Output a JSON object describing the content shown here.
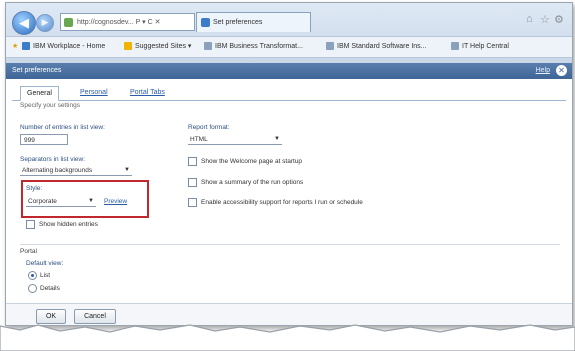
{
  "browser": {
    "address": "http://cognosdev...",
    "address_suffix": "P ▾ C ✕",
    "tab_title": "Set preferences",
    "favorites": [
      {
        "label": "IBM Workplace - Home"
      },
      {
        "label": "Suggested Sites ▾"
      },
      {
        "label": "IBM Business Transformat..."
      },
      {
        "label": "IBM Standard Software Ins..."
      },
      {
        "label": "IT Help Central"
      }
    ]
  },
  "dialog": {
    "title": "Set preferences",
    "help_label": "Help",
    "close_glyph": "✕",
    "tabs": [
      {
        "label": "General"
      },
      {
        "label": "Personal"
      },
      {
        "label": "Portal Tabs"
      }
    ],
    "hint": "Specify your settings",
    "entries_label": "Number of entries in list view:",
    "entries_value": "999",
    "separators_label": "Separators in list view:",
    "separators_value": "Alternating backgrounds",
    "style_label": "Style:",
    "style_value": "Corporate",
    "preview_label": "Preview",
    "show_hidden_label": "Show hidden entries",
    "report_format_label": "Report format:",
    "report_format_value": "HTML",
    "checkbox_welcome": "Show the Welcome page at startup",
    "checkbox_summary": "Show a summary of the run options",
    "checkbox_accessibility": "Enable accessibility support for reports I run or schedule",
    "portal_heading": "Portal",
    "default_view_label": "Default view:",
    "view_list": "List",
    "view_details": "Details",
    "ok_label": "OK",
    "cancel_label": "Cancel"
  },
  "colors": {
    "accent": "#3f6597",
    "highlight_border": "#c0282e",
    "link": "#2a5ca8"
  }
}
